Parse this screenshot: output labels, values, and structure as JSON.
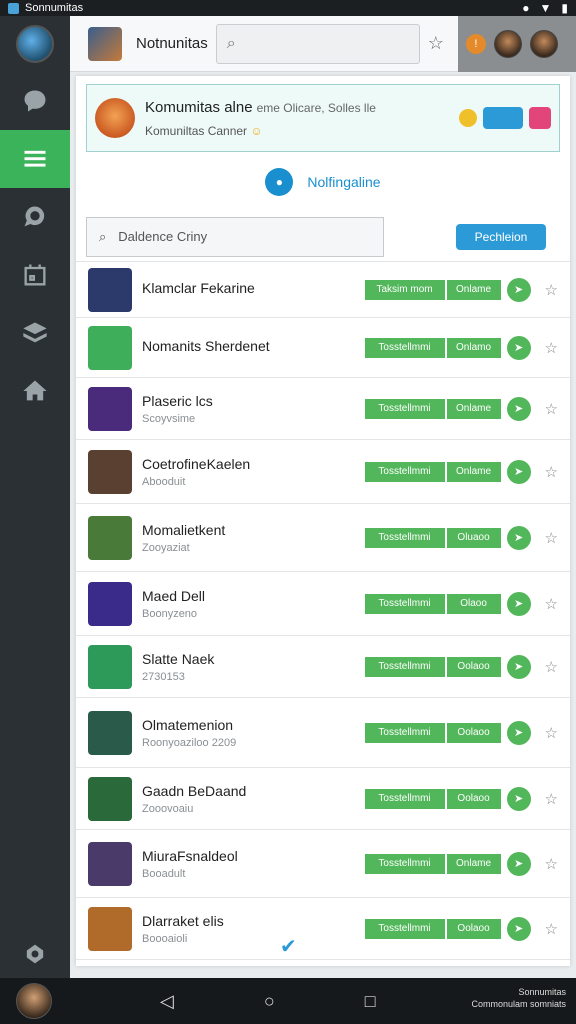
{
  "status_bar": {
    "app_name": "Sonnumitas",
    "icons": [
      "wifi-icon",
      "signal-icon",
      "battery-icon"
    ]
  },
  "header": {
    "title": "Notnunitas",
    "search_placeholder": "",
    "badge": "!"
  },
  "banner": {
    "title": "Komumitas alne",
    "title_extra": "eme  Olicare, Solles lle",
    "subtitle": "Komuniltas Canner"
  },
  "status": {
    "text": "Nolfingaline"
  },
  "filter": {
    "placeholder": "Daldence Criny",
    "button_label": "Pechleion"
  },
  "rows": [
    {
      "name": "Klamclar Fekarine",
      "sub": "",
      "tag1": "Taksim mom",
      "tag2": "Onlame",
      "icon_color": "#2b3a6b"
    },
    {
      "name": "Nomanits Sherdenet",
      "sub": "",
      "tag1": "Tosstellmmi",
      "tag2": "Onlamo",
      "icon_color": "#3fae5a"
    },
    {
      "name": "Plaseric lcs",
      "sub": "Scoyvsime",
      "tag1": "Tosstellmmi",
      "tag2": "Onlame",
      "icon_color": "#4a2a7a"
    },
    {
      "name": "CoetrofineKaelen",
      "sub": "Abooduit",
      "tag1": "Tosstellmmi",
      "tag2": "Onlame",
      "icon_color": "#5a4030"
    },
    {
      "name": "Momalietkent",
      "sub": "Zooyaziat",
      "tag1": "Tosstellmmi",
      "tag2": "Oluaoo",
      "icon_color": "#4a7a3a"
    },
    {
      "name": "Maed Dell",
      "sub": "Boonyzeno",
      "tag1": "Tosstellmmi",
      "tag2": "Olaoo",
      "icon_color": "#3a2a8a"
    },
    {
      "name": "Slatte Naek",
      "sub": "2730153",
      "tag1": "Tosstellmmi",
      "tag2": "Oolaoo",
      "icon_color": "#2e9a5a"
    },
    {
      "name": "Olmatemenion",
      "sub": "Roonyoaziloo 2209",
      "tag1": "Tosstellmmi",
      "tag2": "Oolaoo",
      "icon_color": "#2a5a4a"
    },
    {
      "name": "Gaadn BeDaand",
      "sub": "Zooovoaiu",
      "tag1": "Tosstellmmi",
      "tag2": "Oolaoo",
      "icon_color": "#2a6a3a"
    },
    {
      "name": "MiuraFsnaldeol",
      "sub": "Booadult",
      "tag1": "Tosstellmmi",
      "tag2": "Onlame",
      "icon_color": "#4a3a6a"
    },
    {
      "name": "Dlarraket elis",
      "sub": "Boooaioli",
      "tag1": "Tosstellmmi",
      "tag2": "Oolaoo",
      "icon_color": "#b06a2a"
    }
  ],
  "navbar": {
    "caption_1": "Sonnumitas",
    "caption_2": "Commonulam somniats"
  }
}
